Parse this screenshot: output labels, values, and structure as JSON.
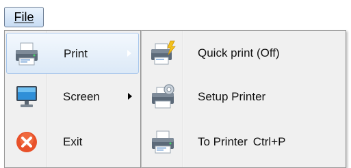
{
  "menubar": {
    "file_label": "File"
  },
  "main_menu": {
    "items": [
      {
        "label": "Print",
        "icon": "printer-icon",
        "has_submenu": true
      },
      {
        "label": "Screen",
        "icon": "monitor-icon",
        "has_submenu": true
      },
      {
        "label": "Exit",
        "icon": "close-circle-icon",
        "has_submenu": false
      }
    ]
  },
  "print_submenu": {
    "items": [
      {
        "label": "Quick print (Off)",
        "icon": "quick-print-icon"
      },
      {
        "label": "Setup Printer",
        "icon": "printer-settings-icon"
      },
      {
        "label": "To Printer",
        "shortcut": "Ctrl+P",
        "icon": "printer-icon"
      }
    ]
  },
  "colors": {
    "highlight_border": "#a8c7ec",
    "menu_bg": "#f0f0f0",
    "exit_icon": "#e8512a"
  }
}
